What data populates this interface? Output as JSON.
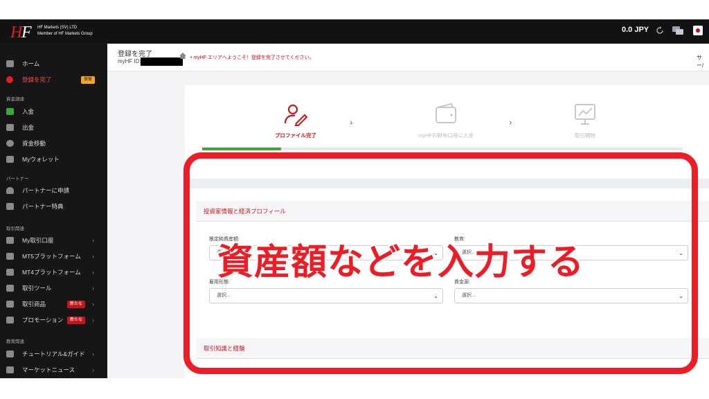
{
  "topbar": {
    "logo_text": "HF",
    "company_line1": "HF Markets (SV) LTD",
    "company_line2": "Member of HF Markets Group",
    "balance": "0.0 JPY"
  },
  "sidebar": {
    "items": [
      {
        "label": "ホーム",
        "icon": "home-icon"
      },
      {
        "label": "登録を完了",
        "icon": "settings-icon",
        "badge": "保留"
      }
    ],
    "sections": [
      {
        "title": "資金調達",
        "items": [
          {
            "label": "入金",
            "icon": "deposit-icon"
          },
          {
            "label": "出金",
            "icon": "withdraw-icon"
          },
          {
            "label": "資金移動",
            "icon": "transfer-icon"
          },
          {
            "label": "Myウォレット",
            "icon": "wallet-icon"
          }
        ]
      },
      {
        "title": "パートナー",
        "items": [
          {
            "label": "パートナーに申請",
            "icon": "user-icon"
          },
          {
            "label": "パートナー特典",
            "icon": "list-icon"
          }
        ]
      },
      {
        "title": "取引関連",
        "items": [
          {
            "label": "My取引口座",
            "icon": "grid-icon"
          },
          {
            "label": "MT5プラットフォーム",
            "icon": "chart-icon"
          },
          {
            "label": "MT4プラットフォーム",
            "icon": "chart-icon"
          },
          {
            "label": "取引ツール",
            "icon": "tools-icon"
          },
          {
            "label": "取引商品",
            "icon": "products-icon",
            "badge": "新たな"
          },
          {
            "label": "プロモーション",
            "icon": "gift-icon",
            "badge": "新たな"
          }
        ]
      },
      {
        "title": "教育関連",
        "items": [
          {
            "label": "チュートリアル&ガイド",
            "icon": "layers-icon"
          },
          {
            "label": "マーケットニュース",
            "icon": "news-icon"
          }
        ]
      }
    ]
  },
  "header": {
    "title": "登録を完了",
    "id_label": "myHF ID:",
    "breadcrumb": "• myHF エリアへようこそ！登録を完了させてください。",
    "support": "サー/"
  },
  "steps": [
    {
      "label": "プロファイル完了",
      "icon": "profile-edit-icon",
      "state": "active"
    },
    {
      "label": "myHFお財布口座に入金",
      "icon": "wallet-icon",
      "state": "inactive"
    },
    {
      "label": "取引開始",
      "icon": "chart-monitor-icon",
      "state": "inactive"
    }
  ],
  "progress": {
    "completed_fraction": 0.16
  },
  "form": {
    "section1_title": "投資家情報と経済プロフィール",
    "fields": [
      {
        "label": "推定純資産額:",
        "value": "選択..."
      },
      {
        "label": "教育:",
        "value": "選択..."
      },
      {
        "label": "雇用形態:",
        "value": "選択..."
      },
      {
        "label": "資金源:",
        "value": "選択..."
      }
    ],
    "section2_title": "取引知識と経験"
  },
  "annotation": {
    "text": "資産額などを入力する",
    "color": "#ee1c25"
  },
  "colors": {
    "accent": "#c4171d",
    "sidebar_bg": "#161616",
    "success": "#3aa835"
  }
}
